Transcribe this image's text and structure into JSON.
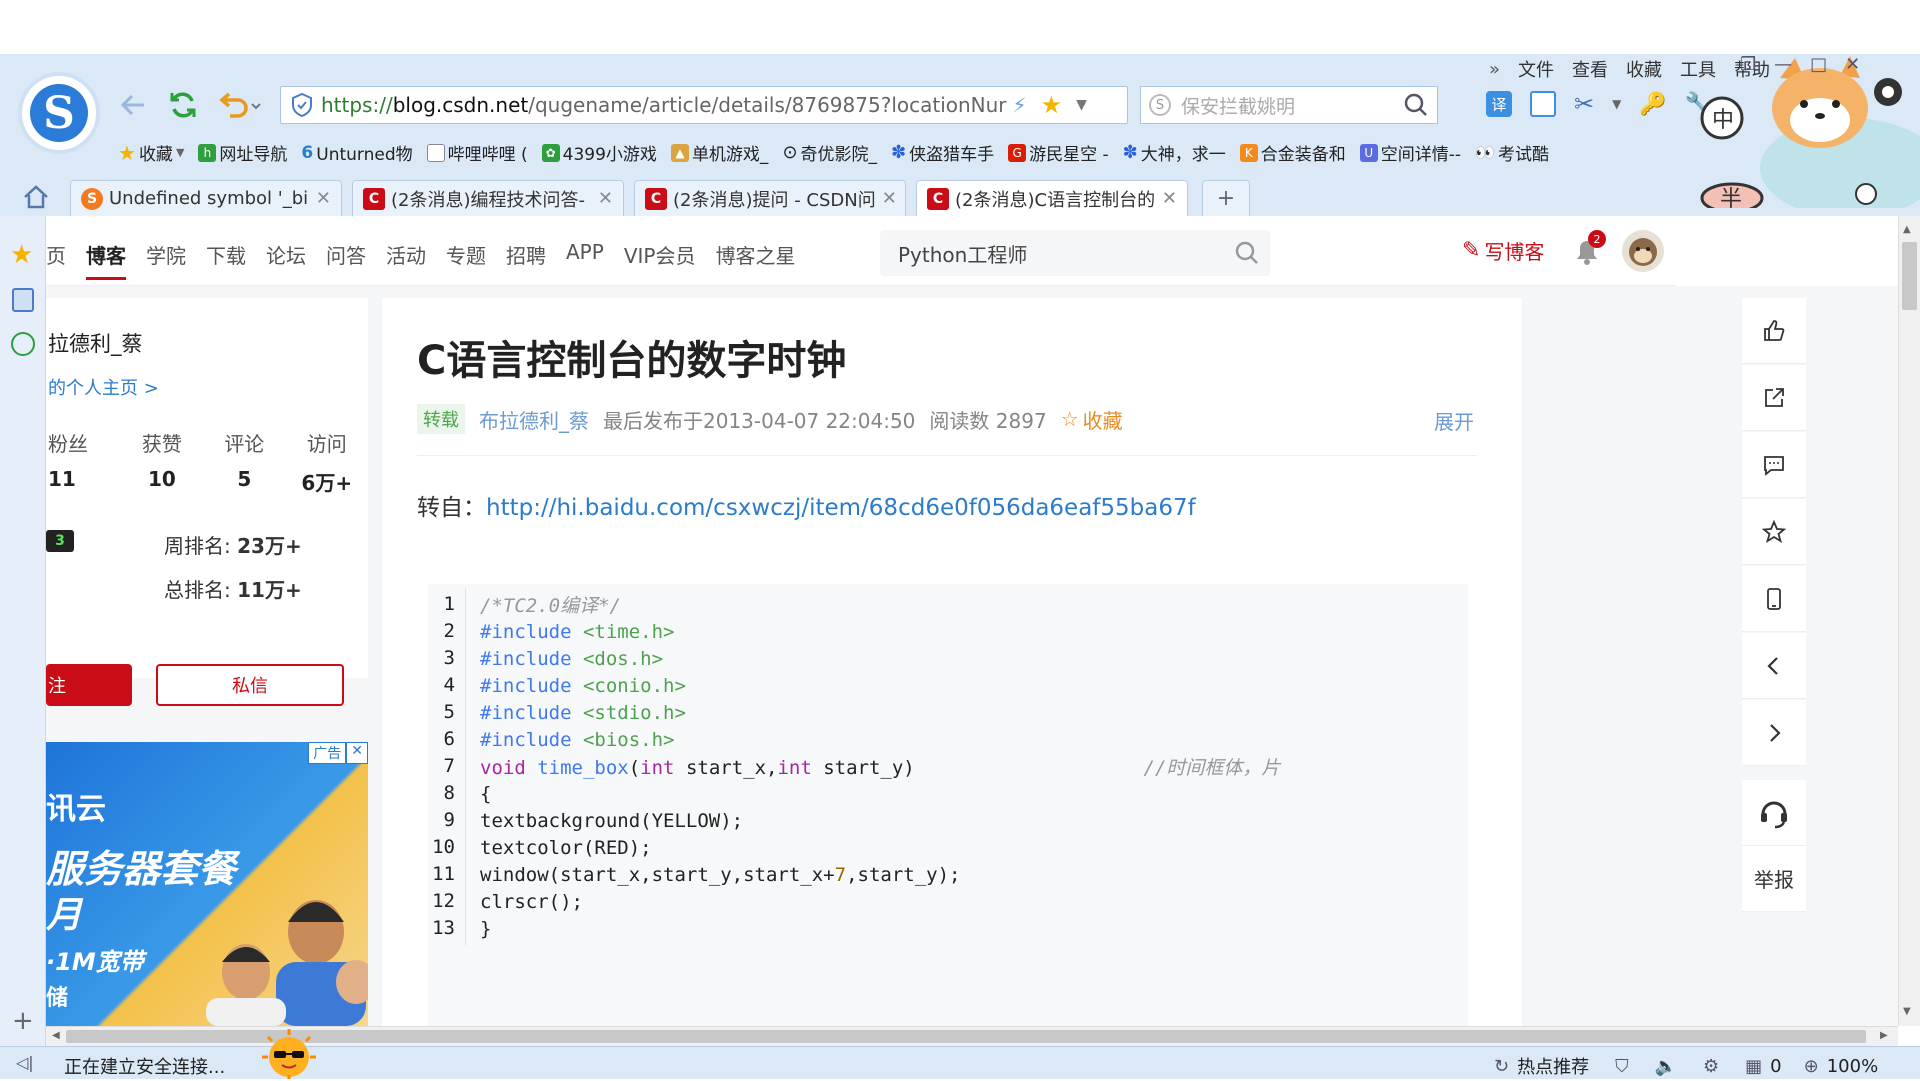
{
  "menubar": {
    "items": [
      "文件",
      "查看",
      "收藏",
      "工具",
      "帮助"
    ]
  },
  "address": {
    "https": "https://",
    "domain": "blog.csdn.net",
    "path": "/qugename/article/details/8769875?locationNur"
  },
  "search": {
    "placeholder": "保安拦截姚明"
  },
  "bookmarks": [
    {
      "label": "收藏",
      "icon": "star-icon",
      "color": "#f5b301"
    },
    {
      "label": "网址导航",
      "icon": "hao-icon",
      "color": "#2e9e3e"
    },
    {
      "label": "Unturned物",
      "icon": "six-icon",
      "color": "#2c7ccb"
    },
    {
      "label": "哔哩哔哩 (",
      "icon": "page-icon",
      "color": "#8aa"
    },
    {
      "label": "4399小游戏",
      "icon": "game-icon",
      "color": "#2e9e3e"
    },
    {
      "label": "单机游戏_",
      "icon": "hat-icon",
      "color": "#d9a441"
    },
    {
      "label": "奇优影院_",
      "icon": "play-icon",
      "color": "#333"
    },
    {
      "label": "侠盗猎车手",
      "icon": "paw-icon",
      "color": "#2c60d8"
    },
    {
      "label": "游民星空 -",
      "icon": "g-icon",
      "color": "#d81e06"
    },
    {
      "label": "大神，求一",
      "icon": "paw-icon",
      "color": "#2c60d8"
    },
    {
      "label": "合金装备和",
      "icon": "k-icon",
      "color": "#f28a1c"
    },
    {
      "label": "空间详情--",
      "icon": "shield-icon",
      "color": "#5a6de0"
    },
    {
      "label": "考试酷",
      "icon": "eye-icon",
      "color": "#d81e06"
    }
  ],
  "tabs": [
    {
      "label": "Undefined symbol '_bi",
      "icon_color": "#f27b20",
      "icon_letter": "S"
    },
    {
      "label": "(2条消息)编程技术问答-",
      "icon_color": "#ca0c16",
      "icon_letter": "C"
    },
    {
      "label": "(2条消息)提问 - CSDN问",
      "icon_color": "#ca0c16",
      "icon_letter": "C"
    },
    {
      "label": "(2条消息)C语言控制台的",
      "icon_color": "#ca0c16",
      "icon_letter": "C"
    }
  ],
  "csdn_nav": {
    "items": [
      "页",
      "博客",
      "学院",
      "下载",
      "论坛",
      "问答",
      "活动",
      "专题",
      "招聘",
      "APP",
      "VIP会员",
      "博客之星"
    ],
    "current": "博客",
    "search_value": "Python工程师",
    "write_label": "写博客",
    "notif_count": "2"
  },
  "profile": {
    "name": "拉德利_蔡",
    "home_link": "的个人主页 >",
    "stats": [
      {
        "label": "粉丝",
        "value": "11"
      },
      {
        "label": "获赞",
        "value": "10"
      },
      {
        "label": "评论",
        "value": "5"
      },
      {
        "label": "访问",
        "value": "6万+"
      }
    ],
    "level": "3",
    "week_rank_label": "周排名:",
    "week_rank": "23万+",
    "total_rank_label": "总排名:",
    "total_rank": "11万+",
    "follow_label": "注",
    "message_label": "私信"
  },
  "ad": {
    "tag": "广告",
    "line1": "讯云",
    "line2": "服务器套餐",
    "line3": "月",
    "line4": "·1M宽带",
    "line5": "储"
  },
  "article": {
    "title": "C语言控制台的数字时钟",
    "tag": "转载",
    "author": "布拉德利_蔡",
    "published": "最后发布于2013-04-07 22:04:50",
    "reads": "阅读数 2897",
    "favorite": "收藏",
    "expand": "展开",
    "source_prefix": "转自：",
    "source_url": "http://hi.baidu.com/csxwczj/item/68cd6e0f056da6eaf55ba67f"
  },
  "code_lines": [
    {
      "n": "1",
      "parts": [
        {
          "t": "/*TC2.0编译*/",
          "c": "c-comment"
        }
      ]
    },
    {
      "n": "2",
      "parts": [
        {
          "t": "#include ",
          "c": "c-pp"
        },
        {
          "t": "<time.h>",
          "c": "c-str"
        }
      ]
    },
    {
      "n": "3",
      "parts": [
        {
          "t": "#include ",
          "c": "c-pp"
        },
        {
          "t": "<dos.h>",
          "c": "c-str"
        }
      ]
    },
    {
      "n": "4",
      "parts": [
        {
          "t": "#include ",
          "c": "c-pp"
        },
        {
          "t": "<conio.h>",
          "c": "c-str"
        }
      ]
    },
    {
      "n": "5",
      "parts": [
        {
          "t": "#include ",
          "c": "c-pp"
        },
        {
          "t": "<stdio.h>",
          "c": "c-str"
        }
      ]
    },
    {
      "n": "6",
      "parts": [
        {
          "t": "#include ",
          "c": "c-pp"
        },
        {
          "t": "<bios.h>",
          "c": "c-str"
        }
      ]
    },
    {
      "n": "7",
      "parts": [
        {
          "t": "void ",
          "c": "c-kw"
        },
        {
          "t": "time_box",
          "c": "c-fn"
        },
        {
          "t": "(",
          "c": ""
        },
        {
          "t": "int",
          "c": "c-kw"
        },
        {
          "t": " start_x,",
          "c": ""
        },
        {
          "t": "int",
          "c": "c-kw"
        },
        {
          "t": " start_y)",
          "c": ""
        },
        {
          "t": "                    //时间框体，片",
          "c": "c-comment"
        }
      ]
    },
    {
      "n": "8",
      "parts": [
        {
          "t": "{",
          "c": ""
        }
      ]
    },
    {
      "n": "9",
      "parts": [
        {
          "t": "textbackground(YELLOW);",
          "c": ""
        }
      ]
    },
    {
      "n": "10",
      "parts": [
        {
          "t": "textcolor(RED);",
          "c": ""
        }
      ]
    },
    {
      "n": "11",
      "parts": [
        {
          "t": "window(start_x,start_y,start_x+",
          "c": ""
        },
        {
          "t": "7",
          "c": "c-num"
        },
        {
          "t": ",start_y);",
          "c": ""
        }
      ]
    },
    {
      "n": "12",
      "parts": [
        {
          "t": "clrscr();",
          "c": ""
        }
      ]
    },
    {
      "n": "13",
      "parts": [
        {
          "t": "}",
          "c": ""
        }
      ]
    }
  ],
  "right_tools": [
    {
      "name": "like-icon"
    },
    {
      "name": "share-icon"
    },
    {
      "name": "comment-icon"
    },
    {
      "name": "star-icon"
    },
    {
      "name": "mobile-icon"
    },
    {
      "name": "prev-icon"
    },
    {
      "name": "next-icon"
    },
    {
      "name": "support-icon"
    }
  ],
  "report_label": "举报",
  "statusbar": {
    "status": "正在建立安全连接...",
    "hot": "热点推荐",
    "count": "0",
    "zoom": "100%"
  }
}
